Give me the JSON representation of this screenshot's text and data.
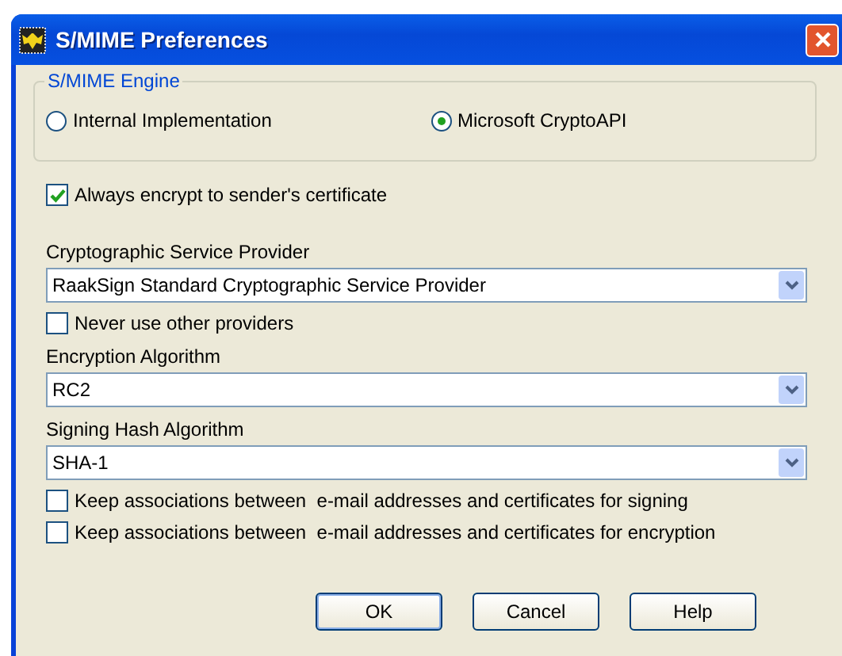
{
  "window": {
    "title": "S/MIME Preferences"
  },
  "engine": {
    "title": "S/MIME Engine",
    "options": [
      {
        "label": "Internal Implementation",
        "selected": false
      },
      {
        "label": "Microsoft CryptoAPI",
        "selected": true
      }
    ]
  },
  "items": [
    {
      "kind": "checkbox",
      "label": "Always encrypt to sender's certificate",
      "checked": true
    },
    {
      "kind": "label",
      "label": "Cryptographic Service Provider"
    },
    {
      "kind": "combo",
      "value": "RaakSign Standard Cryptographic Service Provider"
    },
    {
      "kind": "checkbox",
      "label": "Never use other providers",
      "checked": false
    },
    {
      "kind": "label",
      "label": "Encryption Algorithm"
    },
    {
      "kind": "combo",
      "value": "RC2"
    },
    {
      "kind": "label",
      "label": "Signing Hash Algorithm"
    },
    {
      "kind": "combo",
      "value": "SHA-1"
    },
    {
      "kind": "checkbox",
      "label": "Keep associations between  e-mail addresses and certificates for signing",
      "checked": false
    },
    {
      "kind": "checkbox",
      "label": "Keep associations between  e-mail addresses and certificates for encryption",
      "checked": false
    }
  ],
  "buttons": [
    "OK",
    "Cancel",
    "Help"
  ]
}
